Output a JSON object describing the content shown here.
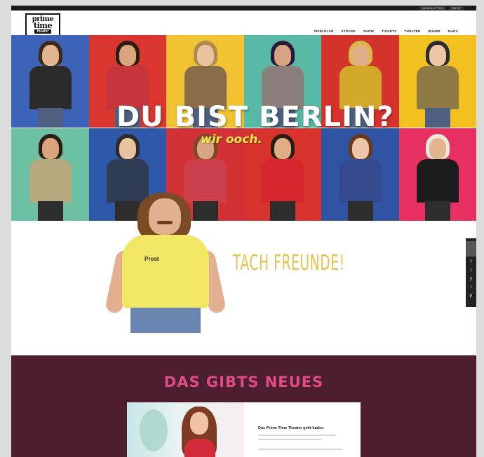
{
  "topbar": {
    "links": [
      "NEWSLETTER",
      "SHOP"
    ]
  },
  "header": {
    "logo": {
      "line1": "prime",
      "line2": "time",
      "line3": "theater"
    },
    "nav": [
      "SPIELPLAN",
      "STÜCKE",
      "SHOW",
      "TICKETS",
      "THEATER",
      "BÜHNE",
      "BARS"
    ]
  },
  "hero": {
    "title": "DU BIST BERLIN?",
    "subtitle": "wir ooch."
  },
  "intro": {
    "greeting": "TACH FREUNDE!",
    "shirt_text": "Prost"
  },
  "social": {
    "icons": [
      "f",
      "t",
      "y",
      "i",
      "p"
    ]
  },
  "news": {
    "title": "DAS GIBTS NEUES",
    "card_headline": "Das Prime Time Theater geht baden"
  },
  "colors": {
    "news_bg": "#4d1f2e",
    "news_title": "#e14c87",
    "greeting": "#e6c24d",
    "hero_subtitle": "#f3e64a"
  }
}
